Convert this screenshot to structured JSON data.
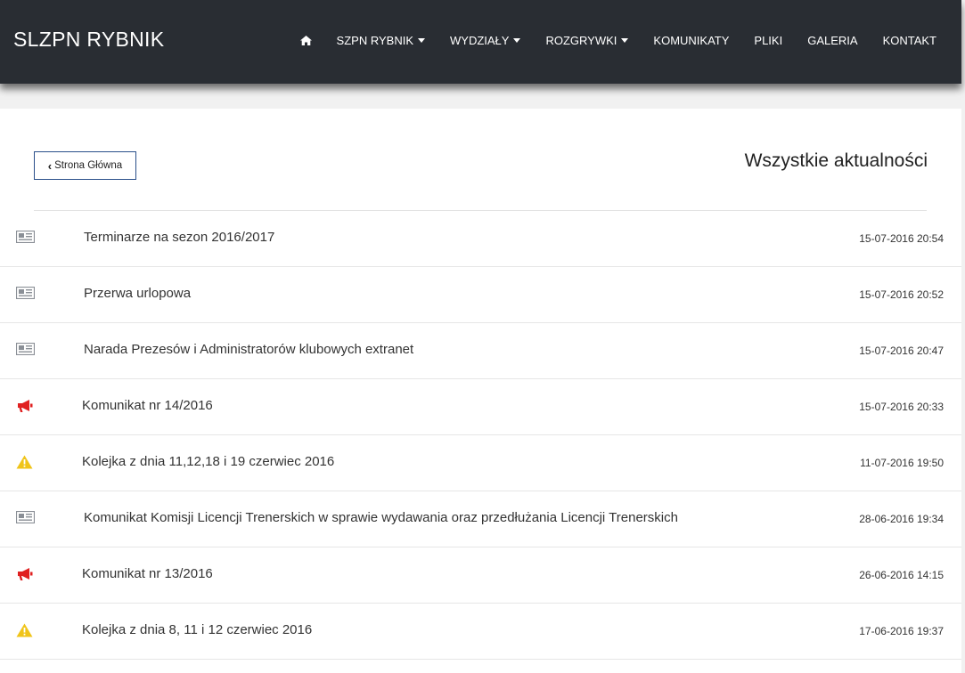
{
  "brand": "SLZPN RYBNIK",
  "nav": [
    {
      "label": "SZPN RYBNIK",
      "dropdown": true
    },
    {
      "label": "WYDZIAŁY",
      "dropdown": true
    },
    {
      "label": "ROZGRYWKI",
      "dropdown": true
    },
    {
      "label": "KOMUNIKATY",
      "dropdown": false
    },
    {
      "label": "PLIKI",
      "dropdown": false
    },
    {
      "label": "GALERIA",
      "dropdown": false
    },
    {
      "label": "KONTAKT",
      "dropdown": false
    }
  ],
  "back_button": "Strona Główna",
  "heading": "Wszystkie aktualności",
  "colors": {
    "navbar": "#292d33",
    "megaphone": "#e02020",
    "warning": "#f0c419",
    "news": "#8a8f96"
  },
  "news": [
    {
      "icon": "newspaper-icon",
      "title": "Terminarze na sezon 2016/2017",
      "date": "15-07-2016 20:54"
    },
    {
      "icon": "newspaper-icon",
      "title": "Przerwa urlopowa",
      "date": "15-07-2016 20:52"
    },
    {
      "icon": "newspaper-icon",
      "title": "Narada Prezesów i Administratorów klubowych extranet",
      "date": "15-07-2016 20:47"
    },
    {
      "icon": "megaphone-icon",
      "title": "Komunikat nr 14/2016",
      "date": "15-07-2016 20:33"
    },
    {
      "icon": "warning-icon",
      "title": "Kolejka z dnia 11,12,18 i 19 czerwiec 2016",
      "date": "11-07-2016 19:50"
    },
    {
      "icon": "newspaper-icon",
      "title": "Komunikat Komisji Licencji Trenerskich w sprawie wydawania oraz przedłużania Licencji Trenerskich",
      "date": "28-06-2016 19:34"
    },
    {
      "icon": "megaphone-icon",
      "title": "Komunikat nr 13/2016",
      "date": "26-06-2016 14:15"
    },
    {
      "icon": "warning-icon",
      "title": "Kolejka z dnia 8, 11 i 12 czerwiec 2016",
      "date": "17-06-2016 19:37"
    }
  ]
}
